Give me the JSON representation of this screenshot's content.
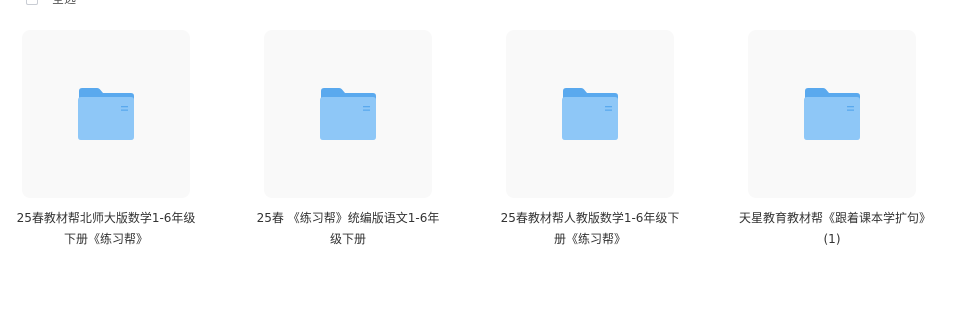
{
  "toolbar": {
    "select_all_label": "全选"
  },
  "files": [
    {
      "name": "25春教材帮北师大版数学1-6年级下册《练习帮》",
      "icon": "folder-icon"
    },
    {
      "name": "25春 《练习帮》统编版语文1-6年级下册",
      "icon": "folder-icon"
    },
    {
      "name": "25春教材帮人教版数学1-6年级下册《练习帮》",
      "icon": "folder-icon"
    },
    {
      "name": "天星教育教材帮《跟着课本学扩句》(1)",
      "icon": "folder-icon"
    }
  ],
  "colors": {
    "folder_back": "#5aa9ee",
    "folder_front": "#8ec7f7",
    "thumb_bg": "#f9f9f9"
  }
}
